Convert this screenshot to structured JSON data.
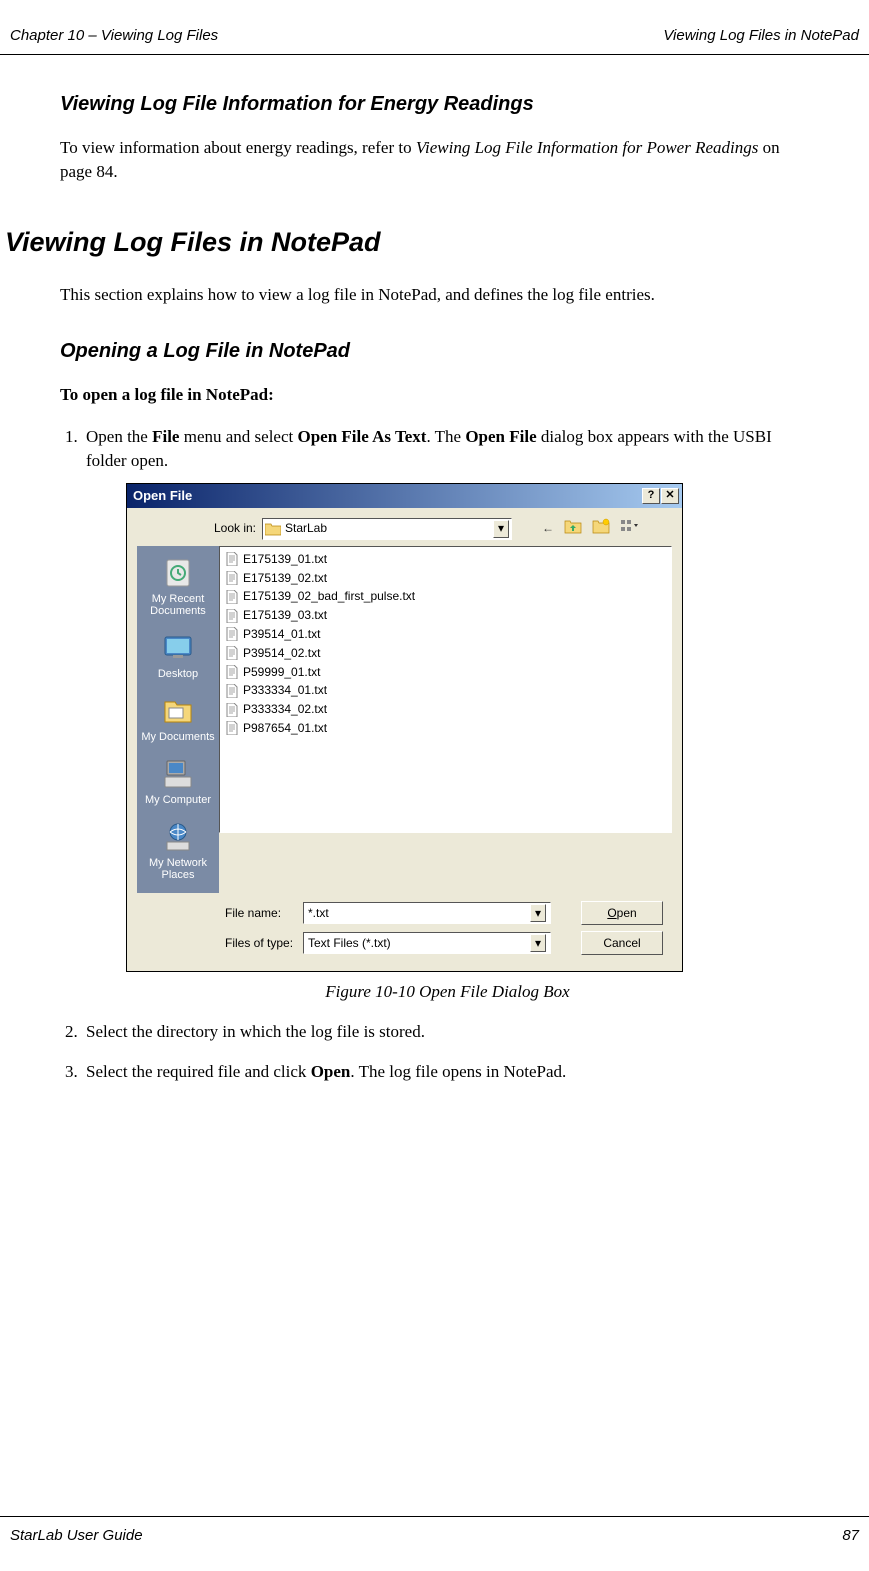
{
  "header": {
    "left": "Chapter 10 – Viewing Log Files",
    "right": "Viewing Log Files in NotePad"
  },
  "sections": {
    "energy_heading": "Viewing Log File Information for Energy Readings",
    "energy_para_pre": "To view information about energy readings, refer to ",
    "energy_para_italic": "Viewing Log File Information for Power Readings",
    "energy_para_post": " on page 84.",
    "main_heading": "Viewing Log Files in NotePad",
    "main_intro": "This section explains how to view a log file in NotePad, and defines the log file entries.",
    "opening_heading": "Opening a Log File in NotePad",
    "open_lead": "To open a log file in NotePad:",
    "step1_a": "Open the ",
    "step1_file": "File",
    "step1_b": " menu and select ",
    "step1_open_as": "Open File As Text",
    "step1_c": ". The ",
    "step1_open_file": "Open File",
    "step1_d": " dialog box appears with the USBI folder open.",
    "figure_caption": "Figure 10-10 Open File Dialog Box",
    "step2": "Select the directory in which the log file is stored.",
    "step3_a": "Select the required file and click ",
    "step3_open": "Open",
    "step3_b": ". The log file opens in NotePad."
  },
  "dialog": {
    "title": "Open File",
    "lookin_label": "Look in:",
    "lookin_value": "StarLab",
    "places": [
      "My Recent Documents",
      "Desktop",
      "My Documents",
      "My Computer",
      "My Network Places"
    ],
    "files": [
      "E175139_01.txt",
      "E175139_02.txt",
      "E175139_02_bad_first_pulse.txt",
      "E175139_03.txt",
      "P39514_01.txt",
      "P39514_02.txt",
      "P59999_01.txt",
      "P333334_01.txt",
      "P333334_02.txt",
      "P987654_01.txt"
    ],
    "filename_label": "File name:",
    "filename_value": "*.txt",
    "filetype_label": "Files of type:",
    "filetype_value": "Text Files (*.txt)",
    "open_btn": "Open",
    "cancel_btn": "Cancel"
  },
  "footer": {
    "left": "StarLab User Guide",
    "right": "87"
  }
}
